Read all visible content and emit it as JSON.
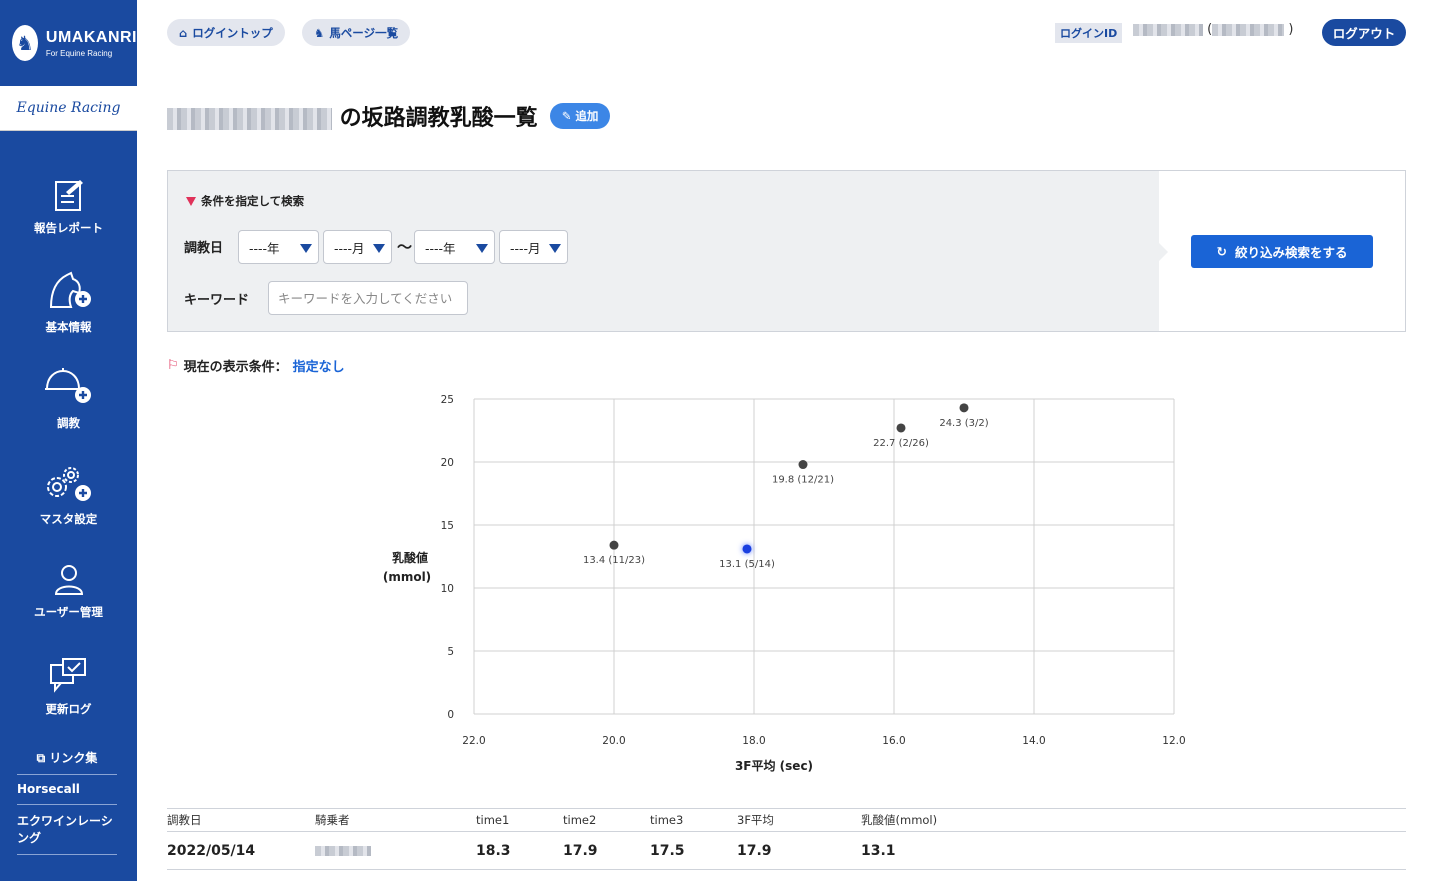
{
  "brand": {
    "name": "UMAKANRI",
    "tagline": "For Equine Racing",
    "partner": "Equine Racing"
  },
  "nav": [
    {
      "label": "報告レポート",
      "icon": "report-icon"
    },
    {
      "label": "基本情報",
      "icon": "horse-plus-icon"
    },
    {
      "label": "調教",
      "icon": "helmet-plus-icon"
    },
    {
      "label": "マスタ設定",
      "icon": "gears-plus-icon"
    },
    {
      "label": "ユーザー管理",
      "icon": "user-icon"
    },
    {
      "label": "更新ログ",
      "icon": "chat-check-icon"
    }
  ],
  "side_links": {
    "links_label": "リンク集",
    "horsecall": "Horsecall",
    "equine": "エクワインレーシング"
  },
  "topbar": {
    "login_top": "ログイントップ",
    "horse_list": "馬ページ一覧",
    "login_id_label": "ログインID",
    "logout": "ログアウト"
  },
  "page": {
    "title_suffix": "の坂路調教乳酸一覧",
    "add_label": "追加"
  },
  "search": {
    "heading": "条件を指定して検索",
    "date_label": "調教日",
    "year_from": "----年",
    "month_from": "----月",
    "tilde": "〜",
    "year_to": "----年",
    "month_to": "----月",
    "keyword_label": "キーワード",
    "keyword_placeholder": "キーワードを入力してください",
    "button": "絞り込み検索をする"
  },
  "condition": {
    "label": "現在の表示条件：",
    "value": "指定なし"
  },
  "chart_data": {
    "type": "scatter",
    "xlabel": "3F平均 (sec)",
    "ylabel_line1": "乳酸値",
    "ylabel_line2": "(mmol)",
    "xlim": [
      22.0,
      12.0
    ],
    "ylim": [
      0,
      25
    ],
    "x_ticks": [
      "22.0",
      "20.0",
      "18.0",
      "16.0",
      "14.0",
      "12.0"
    ],
    "y_ticks": [
      "25",
      "20",
      "15",
      "10",
      "5",
      "0"
    ],
    "grid": true,
    "points": [
      {
        "x": 20.0,
        "y": 13.4,
        "label": "13.4 (11/23)",
        "highlight": false
      },
      {
        "x": 18.1,
        "y": 13.1,
        "label": "13.1 (5/14)",
        "highlight": true
      },
      {
        "x": 17.3,
        "y": 19.8,
        "label": "19.8 (12/21)",
        "highlight": false
      },
      {
        "x": 15.9,
        "y": 22.7,
        "label": "22.7 (2/26)",
        "highlight": false
      },
      {
        "x": 15.0,
        "y": 24.3,
        "label": "24.3 (3/2)",
        "highlight": false
      }
    ],
    "colors": {
      "point": "#444444",
      "highlight": "#1a3fe0"
    }
  },
  "table": {
    "headers": [
      "調教日",
      "騎乗者",
      "time1",
      "time2",
      "time3",
      "3F平均",
      "乳酸値(mmol)"
    ],
    "rows": [
      {
        "date": "2022/05/14",
        "time1": "18.3",
        "time2": "17.9",
        "time3": "17.5",
        "avg": "17.9",
        "lactate": "13.1"
      }
    ]
  }
}
